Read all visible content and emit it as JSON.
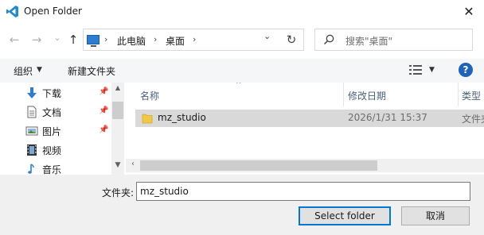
{
  "window": {
    "title": "Open Folder",
    "close_glyph": "✕",
    "app_icon": "vscode-icon"
  },
  "nav": {
    "back_glyph": "←",
    "forward_glyph": "→",
    "recent_glyph": "⌄",
    "up_glyph": "↑",
    "refresh_glyph": "↻"
  },
  "address": {
    "sep_glyph": "›",
    "segments": [
      "此电脑",
      "桌面"
    ],
    "dropdown_glyph": "⌄"
  },
  "search": {
    "placeholder": "搜索\"桌面\""
  },
  "toolbar": {
    "organize_label": "组织",
    "new_folder_label": "新建文件夹",
    "caret_glyph": "▼",
    "help_glyph": "?"
  },
  "sidebar": {
    "pin_glyph": "📌",
    "items": [
      {
        "label": "下载",
        "icon": "download-icon",
        "pinned": true
      },
      {
        "label": "文档",
        "icon": "document-icon",
        "pinned": true
      },
      {
        "label": "图片",
        "icon": "picture-icon",
        "pinned": true
      },
      {
        "label": "视频",
        "icon": "video-icon",
        "pinned": false
      },
      {
        "label": "音乐",
        "icon": "music-icon",
        "pinned": false
      }
    ]
  },
  "file_list": {
    "columns": [
      "名称",
      "修改日期",
      "类型"
    ],
    "rows": [
      {
        "name": "mz_studio",
        "modified": "2026/1/31 15:37",
        "type": "文件夹"
      }
    ]
  },
  "footer": {
    "filename_label": "文件夹:",
    "filename_value": "mz_studio",
    "select_button": "Select folder",
    "cancel_button": "取消"
  },
  "colors": {
    "accent": "#0078d7",
    "folder": "#f2c744",
    "selected_row": "#d9d9d9",
    "help": "#1e64b8"
  }
}
